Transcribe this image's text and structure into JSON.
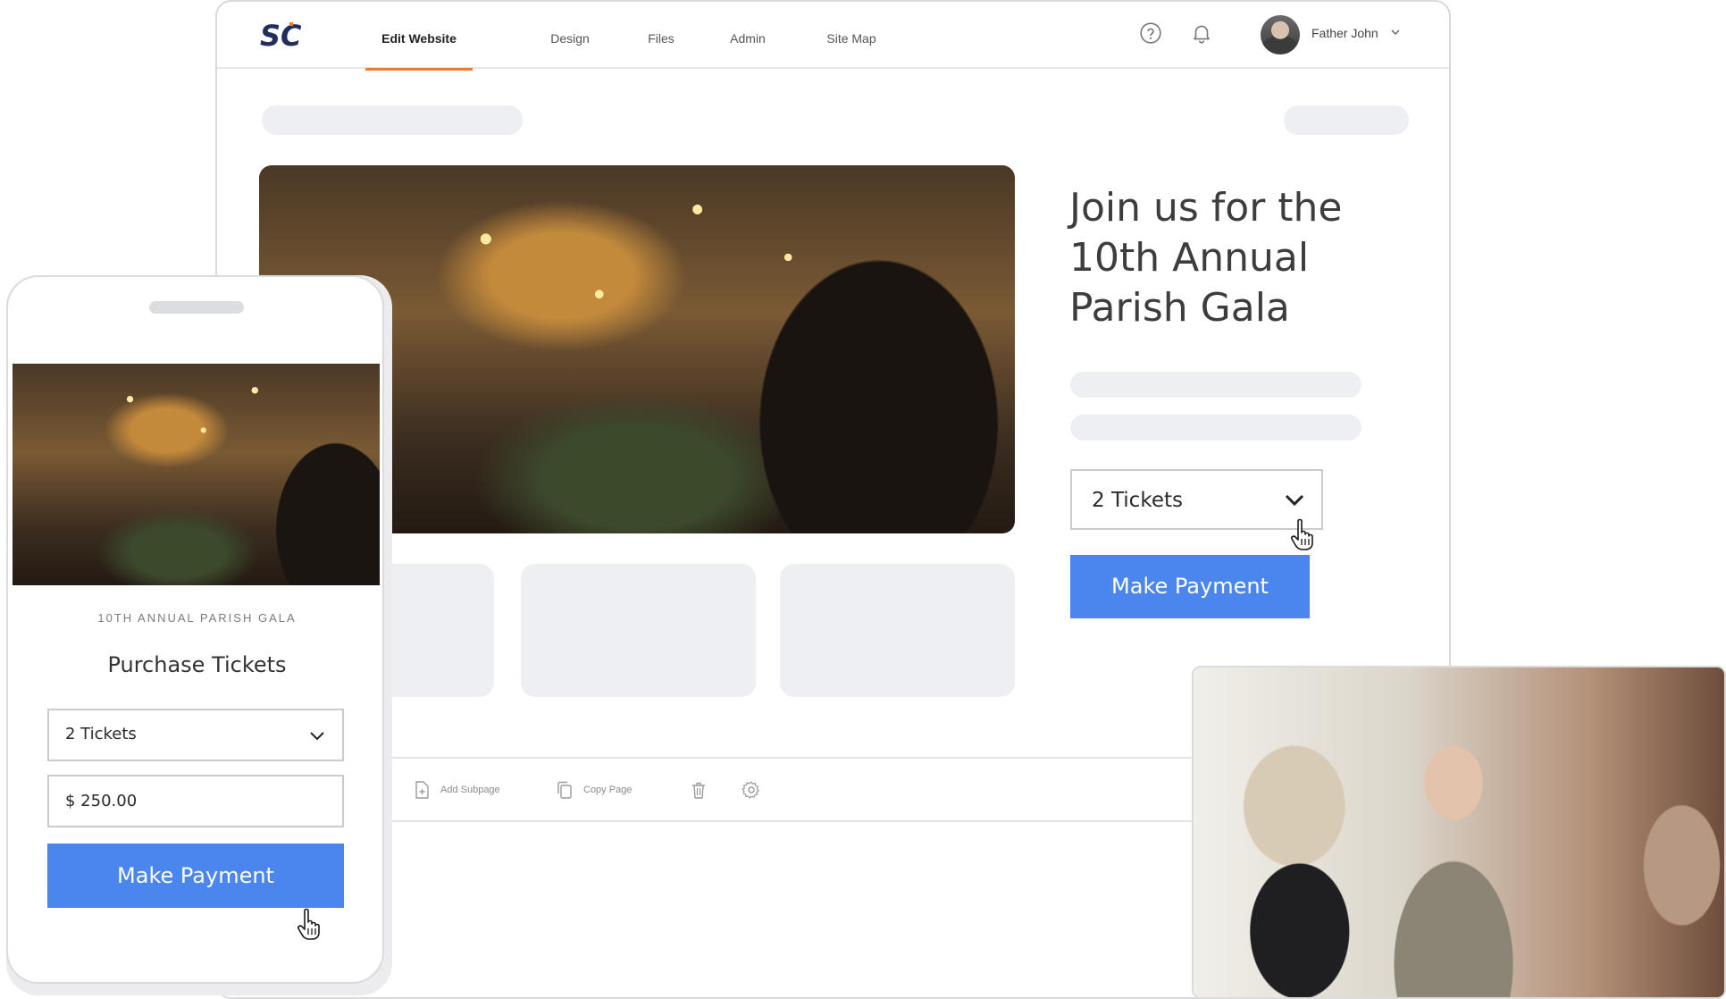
{
  "editor": {
    "logo_text": "SC",
    "nav": {
      "edit_website": "Edit Website",
      "design": "Design",
      "files": "Files",
      "admin": "Admin",
      "site_map": "Site Map"
    },
    "user": {
      "name": "Father John"
    },
    "hero": {
      "title": "Join us for the 10th Annual Parish Gala",
      "ticket_select": "2 Tickets",
      "pay_button": "Make Payment"
    },
    "toolbar": {
      "add_subpage": "Add Subpage",
      "copy_page": "Copy Page"
    }
  },
  "mobile": {
    "eyebrow": "10TH ANNUAL PARISH GALA",
    "heading": "Purchase Tickets",
    "ticket_select": "2 Tickets",
    "amount_value": "$ 250.00",
    "pay_button": "Make Payment"
  },
  "colors": {
    "accent_orange": "#f07a2e",
    "button_blue": "#4a86ee",
    "logo_navy": "#1f2f5a"
  }
}
